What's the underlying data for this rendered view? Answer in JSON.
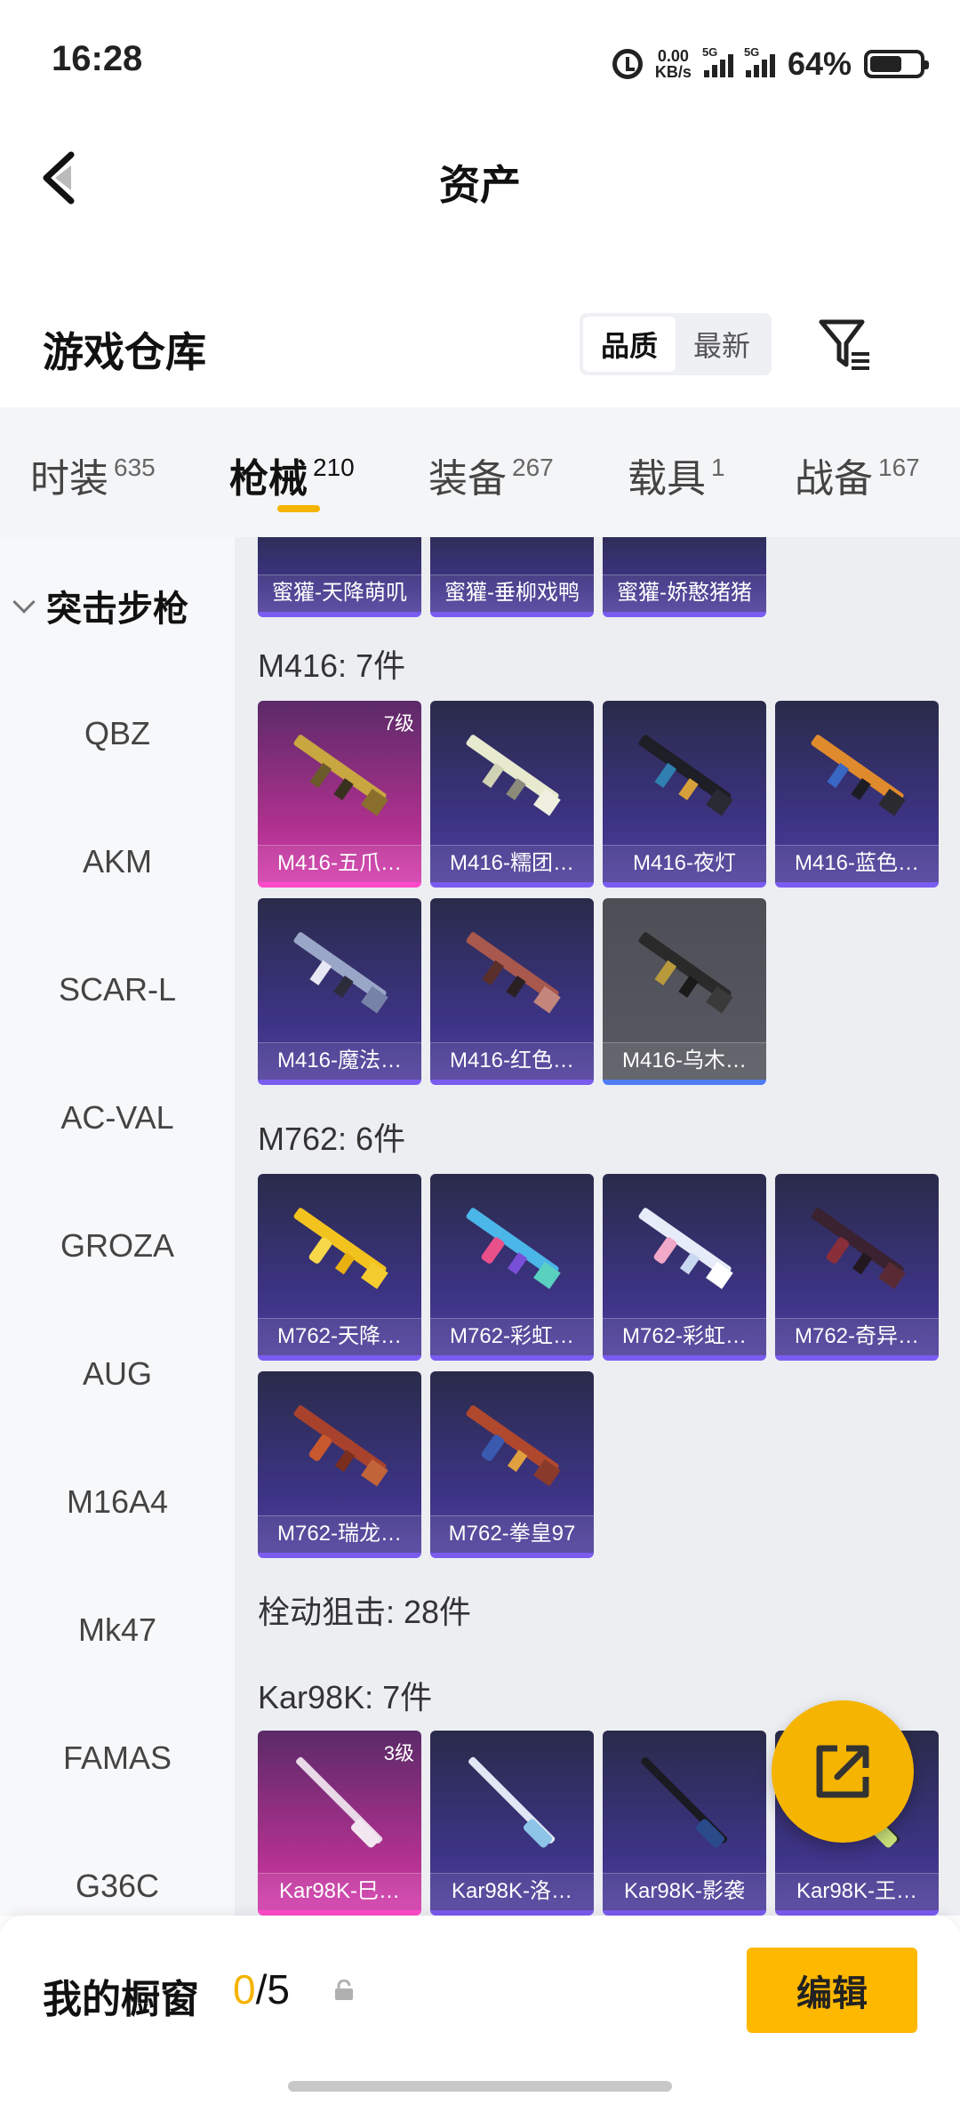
{
  "status_bar": {
    "time": "16:28",
    "net_speed_value": "0.00",
    "net_speed_unit": "KB/s",
    "sim1": "5G",
    "sim2": "5G",
    "battery_text": "64%",
    "battery_level": 0.64
  },
  "header": {
    "title": "资产"
  },
  "warehouse": {
    "title": "游戏仓库",
    "sort_options": [
      "品质",
      "最新"
    ],
    "sort_selected": "品质"
  },
  "tabs": [
    {
      "label": "时装",
      "count": "635"
    },
    {
      "label": "枪械",
      "count": "210",
      "active": true
    },
    {
      "label": "装备",
      "count": "267"
    },
    {
      "label": "载具",
      "count": "1"
    },
    {
      "label": "战备",
      "count": "167"
    }
  ],
  "sidebar": {
    "group": "突击步枪",
    "items": [
      "QBZ",
      "AKM",
      "SCAR-L",
      "AC-VAL",
      "GROZA",
      "AUG",
      "M16A4",
      "Mk47",
      "FAMAS",
      "G36C"
    ]
  },
  "content": {
    "top_partial": [
      "蜜獾-天降萌叽",
      "蜜獾-垂柳戏鸭",
      "蜜獾-娇憨猪猪"
    ],
    "groups": [
      {
        "title": "M416: 7件",
        "items": [
          {
            "label": "M416-五爪…",
            "level": "7级",
            "rarity": "pink"
          },
          {
            "label": "M416-糯团…",
            "rarity": "purple"
          },
          {
            "label": "M416-夜灯",
            "rarity": "purple"
          },
          {
            "label": "M416-蓝色…",
            "rarity": "purple"
          },
          {
            "label": "M416-魔法…",
            "rarity": "purple"
          },
          {
            "label": "M416-红色…",
            "rarity": "purple"
          },
          {
            "label": "M416-乌木…",
            "rarity": "gray"
          }
        ]
      },
      {
        "title": "M762: 6件",
        "items": [
          {
            "label": "M762-天降…",
            "rarity": "purple"
          },
          {
            "label": "M762-彩虹…",
            "rarity": "purple"
          },
          {
            "label": "M762-彩虹…",
            "rarity": "purple"
          },
          {
            "label": "M762-奇异…",
            "rarity": "purple"
          },
          {
            "label": "M762-瑞龙…",
            "rarity": "purple"
          },
          {
            "label": "M762-拳皇97",
            "rarity": "purple"
          }
        ]
      },
      {
        "title": "栓动狙击: 28件"
      },
      {
        "title": "Kar98K: 7件",
        "items": [
          {
            "label": "Kar98K-巳…",
            "level": "3级",
            "rarity": "pink"
          },
          {
            "label": "Kar98K-洛…",
            "rarity": "purple"
          },
          {
            "label": "Kar98K-影袭",
            "rarity": "purple"
          },
          {
            "label": "Kar98K-王…",
            "rarity": "purple"
          }
        ]
      }
    ]
  },
  "showcase": {
    "title": "我的橱窗",
    "current": "0",
    "max": "/5",
    "edit_label": "编辑"
  },
  "colors": {
    "accent": "#f5b400",
    "card_purple": "#3d3487",
    "card_pink": "#c2339b",
    "card_gray": "#55565e"
  }
}
